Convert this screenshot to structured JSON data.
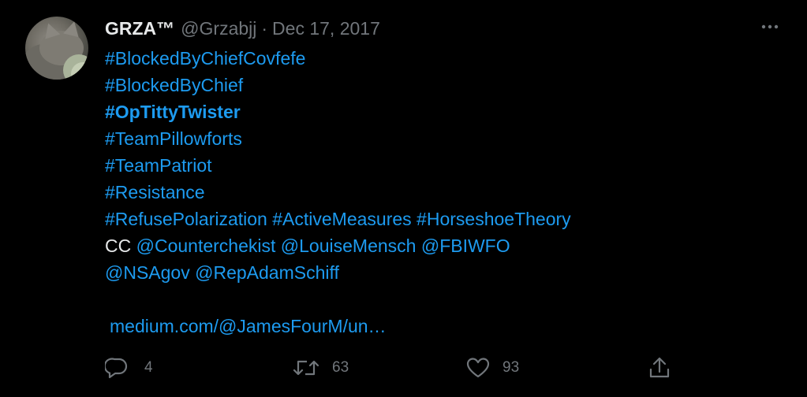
{
  "author": {
    "name": "GRZA™",
    "handle": "@Grzabjj",
    "separator": "·",
    "date": "Dec 17, 2017"
  },
  "body": {
    "line1": "#BlockedByChiefCovfefe",
    "line2": "#BlockedByChief",
    "line3": "#OpTittyTwister",
    "line4": "#TeamPillowforts",
    "line5": "#TeamPatriot",
    "line6": "#Resistance",
    "line7": {
      "tag1": "#RefusePolarization",
      "tag2": "#ActiveMeasures",
      "tag3": "#HorseshoeTheory"
    },
    "line8": {
      "prefix": "CC",
      "mention1": "@Counterchekist",
      "mention2": "@LouiseMensch",
      "mention3": "@FBIWFO"
    },
    "line9": {
      "mention1": "@NSAgov",
      "mention2": "@RepAdamSchiff"
    },
    "link": "medium.com/@JamesFourM/un…"
  },
  "actions": {
    "replies": "4",
    "retweets": "63",
    "likes": "93"
  },
  "icons": {
    "more": "more-icon",
    "reply": "reply-icon",
    "retweet": "retweet-icon",
    "like": "like-icon",
    "share": "share-icon"
  },
  "colors": {
    "background": "#000000",
    "text": "#e7e9ea",
    "secondary": "#71767b",
    "link": "#1d9bf0"
  }
}
